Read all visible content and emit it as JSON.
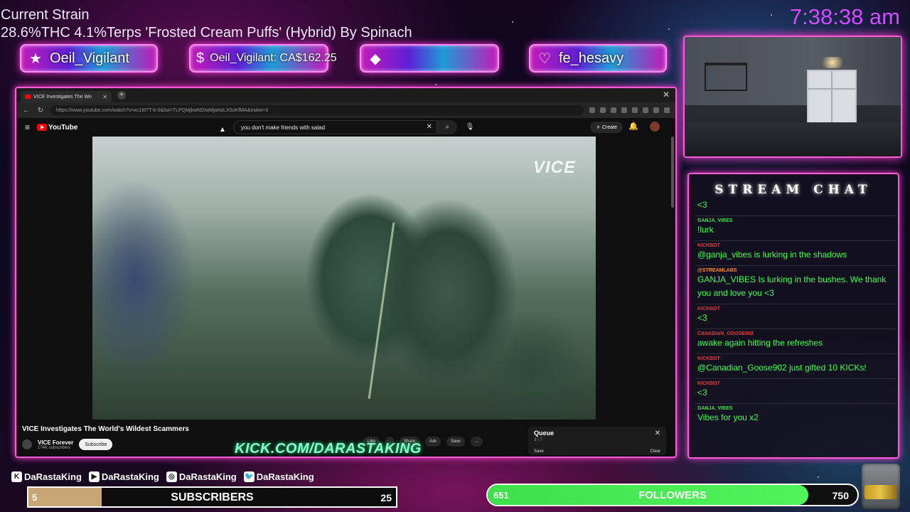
{
  "header": {
    "strain_title": "Current Strain",
    "strain_detail": "28.6%THC 4.1%Terps 'Frosted Cream Puffs' (Hybrid) By Spinach",
    "clock": "7:38:38 am"
  },
  "alerts": [
    {
      "icon": "star-icon",
      "text": "Oeil_Vigilant"
    },
    {
      "icon": "dollar-icon",
      "text": "Oeil_Vigilant: CA$162.25"
    },
    {
      "icon": "diamond-icon",
      "text": ""
    },
    {
      "icon": "heart-icon",
      "text": "fe_hesavy"
    }
  ],
  "browser": {
    "tab_title": "VICE Investigates The Wo",
    "url": "https://www.youtube.com/watch?v=xc1M7T-b-0&list=TLPQMjkwNDIwMjaHzLXSzKfMA&index=3",
    "search_query": "you don't make friends with salad",
    "create_label": "Create",
    "youtube_label": "YouTube",
    "video_watermark": "VICE",
    "video_title": "VICE Investigates The World's Wildest Scammers",
    "channel_name": "VICE Forever",
    "channel_subs": "174K subscribers",
    "subscribe_label": "Subscribe",
    "actions": [
      "Like",
      "",
      "Share",
      "Ask",
      "Save",
      "..."
    ],
    "queue": {
      "title": "Queue",
      "count": "3 / 7",
      "save_label": "Save",
      "clear_label": "Clear"
    }
  },
  "kick_url": "KICK.COM/DARASTAKING",
  "chat": {
    "title": "STREAM CHAT",
    "messages": [
      {
        "user": "",
        "text": "<3",
        "color": "green"
      },
      {
        "user": "GANJA_VIBES",
        "text": "!lurk",
        "color": "green"
      },
      {
        "user": "KICKBOT",
        "text": "@ganja_vibes is lurking in the shadows",
        "color": "red"
      },
      {
        "user": "@STREAMLABS",
        "text": "GANJA_VIBES Is lurking in the bushes. We thank you and love you <3",
        "color": "orange"
      },
      {
        "user": "KICKBOT",
        "text": "<3",
        "color": "red"
      },
      {
        "user": "CANADIAN_GOOSE902",
        "text": "awake again hitting the refreshes",
        "color": "red"
      },
      {
        "user": "KICKBOT",
        "text": "@Canadian_Goose902 just gifted 10 KICKs!",
        "color": "red"
      },
      {
        "user": "KICKBOT",
        "text": "<3",
        "color": "red"
      },
      {
        "user": "GANJA_VIBES",
        "text": "Vibes for you x2",
        "color": "green"
      }
    ]
  },
  "socials": [
    {
      "icon": "kick-icon",
      "handle": "DaRastaKing"
    },
    {
      "icon": "youtube-icon",
      "handle": "DaRastaKing"
    },
    {
      "icon": "instagram-icon",
      "handle": "DaRastaKing"
    },
    {
      "icon": "twitter-icon",
      "handle": "DaRastaKing"
    }
  ],
  "subscribers": {
    "current": "5",
    "label": "SUBSCRIBERS",
    "goal": "25",
    "progress": 0.2
  },
  "followers": {
    "current": "651",
    "label": "FOLLOWERS",
    "goal": "750",
    "progress": 0.868
  }
}
